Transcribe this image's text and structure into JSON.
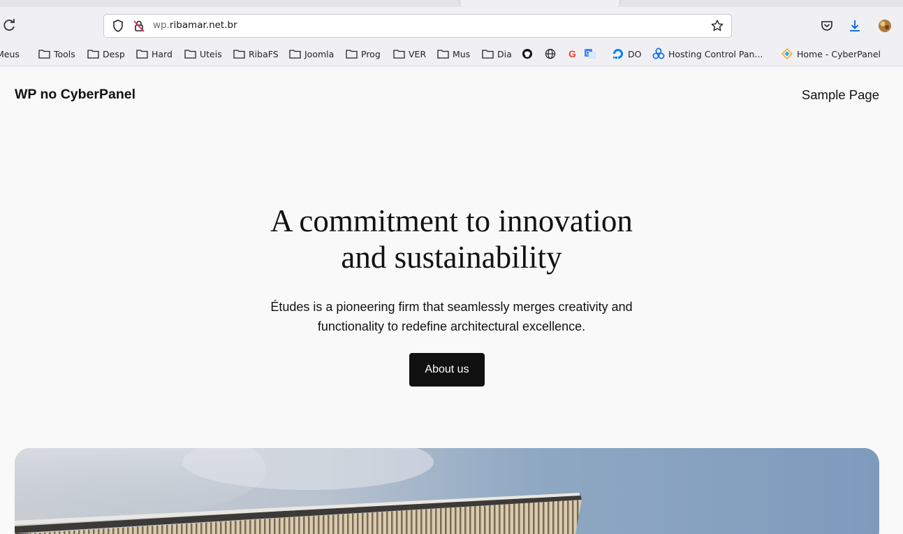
{
  "browser": {
    "url_prefix": "wp.",
    "url_domain": "ribamar.net.br",
    "bookmarks": [
      {
        "label": "Meus",
        "icon": "folder-icon"
      },
      {
        "label": "Tools",
        "icon": "folder-icon"
      },
      {
        "label": "Desp",
        "icon": "folder-icon"
      },
      {
        "label": "Hard",
        "icon": "folder-icon"
      },
      {
        "label": "Uteis",
        "icon": "folder-icon"
      },
      {
        "label": "RibaFS",
        "icon": "folder-icon"
      },
      {
        "label": "Joomla",
        "icon": "folder-icon"
      },
      {
        "label": "Prog",
        "icon": "folder-icon"
      },
      {
        "label": "VER",
        "icon": "folder-icon"
      },
      {
        "label": "Mus",
        "icon": "folder-icon"
      },
      {
        "label": "Dia",
        "icon": "folder-icon"
      },
      {
        "label": "",
        "icon": "github-icon"
      },
      {
        "label": "",
        "icon": "globe-icon"
      },
      {
        "label": "",
        "icon": "google-icon"
      },
      {
        "label": "",
        "icon": "translate-icon"
      },
      {
        "label": "DO",
        "icon": "digitalocean-icon"
      },
      {
        "label": "Hosting Control Pan...",
        "icon": "hosting-icon"
      },
      {
        "label": "Home - CyberPanel",
        "icon": "cyberpanel-icon"
      }
    ]
  },
  "site": {
    "title": "WP no CyberPanel",
    "nav": [
      "Sample Page"
    ]
  },
  "hero": {
    "title_line1": "A commitment to innovation",
    "title_line2": "and sustainability",
    "subtitle_line1": "Études is a pioneering firm that seamlessly merges creativity and",
    "subtitle_line2": "functionality to redefine architectural excellence.",
    "button_label": "About us"
  },
  "colors": {
    "page_background": "#f9f9f9",
    "text": "#111111",
    "button_background": "#111111",
    "button_text": "#ffffff"
  }
}
